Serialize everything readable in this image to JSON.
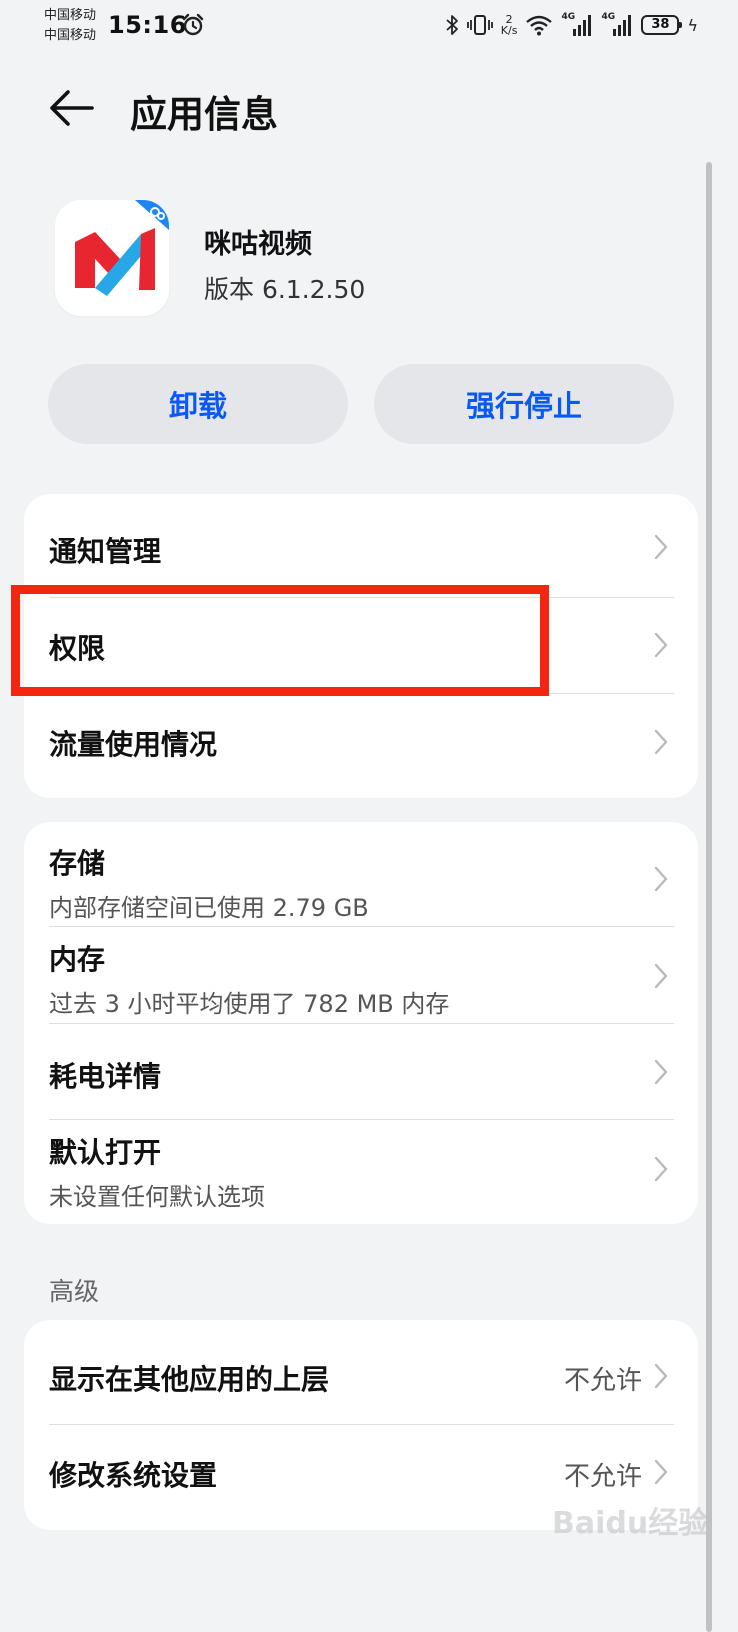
{
  "status_bar": {
    "carrier1": "中国移动",
    "carrier2": "中国移动",
    "time": "15:16",
    "net_speed_value": "2",
    "net_speed_unit": "K/s",
    "signal1_type": "4G",
    "signal2_type": "4G",
    "battery": "38"
  },
  "header": {
    "title": "应用信息"
  },
  "app": {
    "name": "咪咕视频",
    "version": "版本 6.1.2.50"
  },
  "actions": {
    "uninstall_label": "卸载",
    "force_stop_label": "强行停止"
  },
  "card1": {
    "items": [
      {
        "label": "通知管理"
      },
      {
        "label": "权限"
      },
      {
        "label": "流量使用情况"
      }
    ]
  },
  "card2": {
    "items": [
      {
        "label": "存储",
        "sub": "内部存储空间已使用 2.79 GB"
      },
      {
        "label": "内存",
        "sub": "过去 3 小时平均使用了 782 MB 内存"
      },
      {
        "label": "耗电详情"
      },
      {
        "label": "默认打开",
        "sub": "未设置任何默认选项"
      }
    ]
  },
  "advanced": {
    "title": "高级",
    "items": [
      {
        "label": "显示在其他应用的上层",
        "value": "不允许"
      },
      {
        "label": "修改系统设置",
        "value": "不允许"
      }
    ]
  },
  "watermark": "Baidu经验",
  "colors": {
    "accent": "#0a59f7",
    "highlight": "#f42610",
    "background": "#f1f3f5"
  }
}
